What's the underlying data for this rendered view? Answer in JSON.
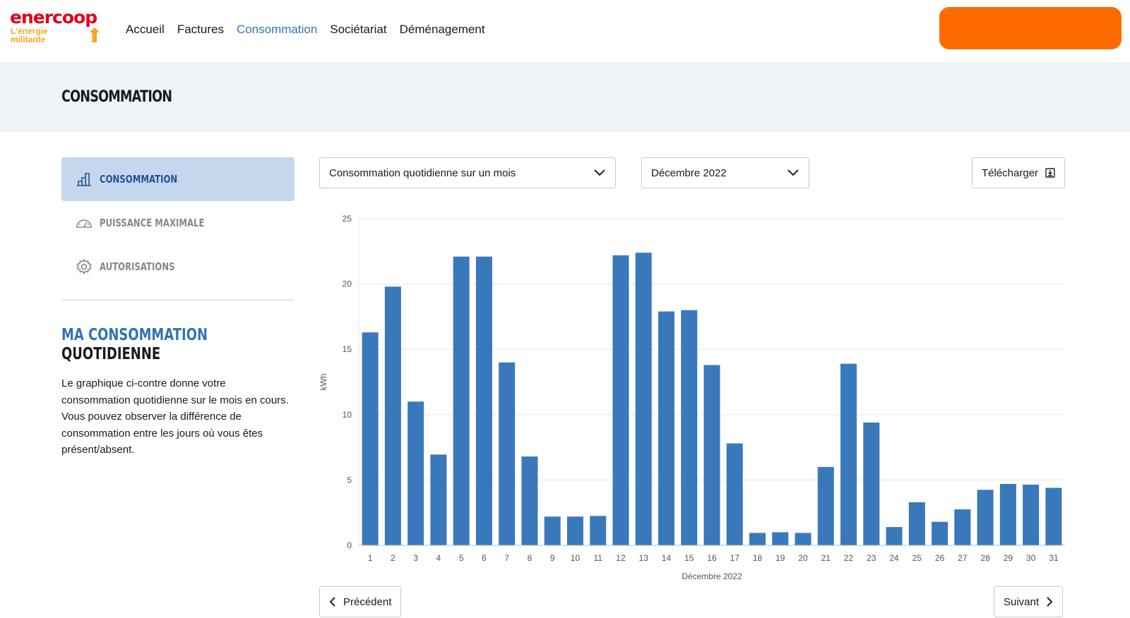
{
  "header": {
    "logo_text": "enercoop",
    "logo_tagline": "L’énergie militante",
    "nav": [
      "Accueil",
      "Factures",
      "Consommation",
      "Sociétariat",
      "Déménagement"
    ],
    "active_nav": "Consommation",
    "accent": "#3273b4",
    "cta_color": "#ff6b00"
  },
  "banner": {
    "title": "CONSOMMATION"
  },
  "sidebar": {
    "items": [
      {
        "label": "CONSOMMATION",
        "icon": "bar-chart-icon",
        "active": true
      },
      {
        "label": "PUISSANCE MAXIMALE",
        "icon": "gauge-icon"
      },
      {
        "label": "AUTORISATIONS",
        "icon": "gear-icon"
      }
    ],
    "heading_line1": "MA CONSOMMATION",
    "heading_line2": "QUOTIDIENNE",
    "description": "Le graphique ci-contre donne votre consommation quotidienne sur le mois en cours. Vous pouvez observer la différence de consommation entre les jours où vous êtes présent/absent."
  },
  "controls": {
    "view_select": "Consommation quotidienne sur un mois",
    "month_select": "Décembre 2022",
    "download": "Télécharger",
    "prev": "Précédent",
    "next": "Suivant"
  },
  "chart_data": {
    "type": "bar",
    "xlabel": "Décembre 2022",
    "ylabel": "kWh",
    "ylim": [
      0,
      25
    ],
    "yticks": [
      0,
      5,
      10,
      15,
      20,
      25
    ],
    "grid": true,
    "color": "#3a78bc",
    "categories": [
      "1",
      "2",
      "3",
      "4",
      "5",
      "6",
      "7",
      "8",
      "9",
      "10",
      "11",
      "12",
      "13",
      "14",
      "15",
      "16",
      "17",
      "18",
      "19",
      "20",
      "21",
      "22",
      "23",
      "24",
      "25",
      "26",
      "27",
      "28",
      "29",
      "30",
      "31"
    ],
    "values": [
      16.3,
      19.8,
      11.0,
      6.95,
      22.1,
      22.1,
      14.0,
      6.8,
      2.2,
      2.2,
      2.25,
      22.2,
      22.4,
      17.9,
      18.0,
      13.8,
      7.8,
      0.95,
      1.0,
      0.95,
      6.0,
      13.9,
      9.4,
      1.4,
      3.3,
      1.8,
      2.75,
      4.25,
      4.7,
      4.65,
      4.4
    ]
  }
}
